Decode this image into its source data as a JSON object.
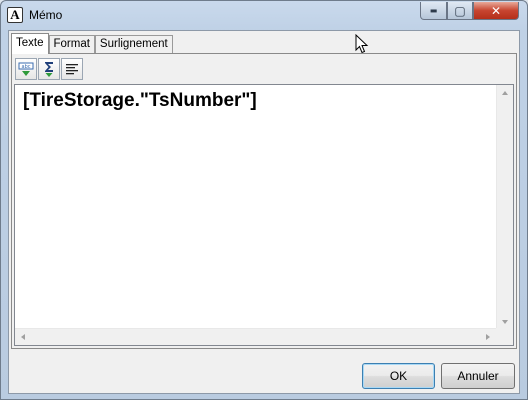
{
  "window": {
    "title": "Mémo",
    "app_icon_glyph": "A",
    "minimize_glyph": "▬",
    "maximize_glyph": "▢",
    "close_glyph": "✕"
  },
  "tabs": [
    {
      "label": "Texte",
      "active": true
    },
    {
      "label": "Format",
      "active": false
    },
    {
      "label": "Surlignement",
      "active": false
    }
  ],
  "toolbar": {
    "tools": [
      {
        "icon": "insert-variable-icon"
      },
      {
        "icon": "insert-expression-sum-icon"
      },
      {
        "icon": "text-align-icon"
      }
    ]
  },
  "editor": {
    "content": "[TireStorage.\"TsNumber\"]"
  },
  "buttons": {
    "ok_label": "OK",
    "cancel_label": "Annuler"
  },
  "colors": {
    "close_button": "#c74530",
    "default_button_border": "#3c7fb1",
    "title_bar": "#c9d9ec"
  }
}
